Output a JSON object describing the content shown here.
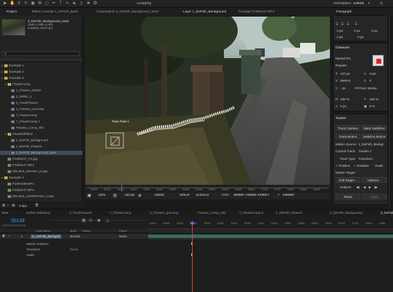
{
  "workspace": {
    "label": "Workspace:",
    "value": "Effects",
    "snapping": "Snapping"
  },
  "panel_tabs": [
    {
      "label": "Project"
    },
    {
      "label": "Effect Controls 1_DeFish_Back"
    },
    {
      "label": "Composition 3_DeFish_Background_track"
    },
    {
      "label": "Layer 1_DeFish_Background"
    },
    {
      "label": "Footage P1050247.MP4"
    },
    {
      "label": "Paragraph"
    }
  ],
  "project": {
    "selected_name": "3_DeFish_Background_track",
    "selected_dims": "1540 x 1080 (1.00)",
    "selected_dur": "Δ 00915, 29.97 fps",
    "items": [
      {
        "label": "Example 1",
        "type": "folder",
        "indent": 0
      },
      {
        "label": "Example 2",
        "type": "folder",
        "indent": 0
      },
      {
        "label": "Example 3",
        "type": "folder",
        "indent": 0
      },
      {
        "label": "FlowerComp",
        "type": "folder",
        "indent": 1
      },
      {
        "label": "1_Flowers_Defish",
        "type": "comp",
        "indent": 2
      },
      {
        "label": "2_Defish_2",
        "type": "comp",
        "indent": 2
      },
      {
        "label": "3_TrackFlowers",
        "type": "comp",
        "indent": 2
      },
      {
        "label": "4_Flowers_precomp",
        "type": "comp",
        "indent": 2
      },
      {
        "label": "7_FlowerComp",
        "type": "comp",
        "indent": 2
      },
      {
        "label": "7_FlowerComp 2",
        "type": "comp",
        "indent": 2
      },
      {
        "label": "Flowers_Comp_Old",
        "type": "comp",
        "indent": 2
      },
      {
        "label": "FlowerDEfish2",
        "type": "folder",
        "indent": 1
      },
      {
        "label": "2_DeFish_Background",
        "type": "comp",
        "indent": 2
      },
      {
        "label": "2_DeFish_Flowers",
        "type": "comp",
        "indent": 2
      },
      {
        "label": "3_DeFish_Background_track",
        "type": "comp",
        "indent": 2
      },
      {
        "label": "P1050247_FS.jpg",
        "type": "foot",
        "indent": 1
      },
      {
        "label": "P1050247.MP4",
        "type": "foot",
        "indent": 1
      },
      {
        "label": "REL8NS_DEFISH_E.aep",
        "type": "foot",
        "indent": 1
      },
      {
        "label": "Example 4",
        "type": "folder",
        "indent": 0
      },
      {
        "label": "P1050189.MP4",
        "type": "foot",
        "indent": 1
      },
      {
        "label": "P1050247.MP4",
        "type": "foot",
        "indent": 1
      },
      {
        "label": "REL8NS_SUPERFISH_4.aep",
        "type": "foot",
        "indent": 1
      }
    ],
    "bpc": "8 bpc"
  },
  "viewer": {
    "track_point": "Track Point 1",
    "ruler": [
      "00050",
      "00100",
      "00150",
      "00200",
      "00250",
      "00300",
      "00350",
      "00400",
      "00450",
      "00500",
      "00550",
      "00600",
      "00650",
      "00700",
      "00750",
      "00800",
      "00850",
      "00900"
    ],
    "zoom": "50%",
    "timecode": "00138",
    "in_point": "00000",
    "out_point": "00914",
    "duration": "Δ 00915",
    "view_label": "View:",
    "view_value": "Motion Tracker Points",
    "render": "Render"
  },
  "paragraph": {
    "title": "Paragraph",
    "rows": [
      [
        "0 px",
        "0 px",
        "0 px"
      ],
      [
        "0 px",
        "0 px"
      ]
    ]
  },
  "character": {
    "title": "Character",
    "font": "Myriad Pro",
    "style": "Regular",
    "size": "137 px",
    "leading": "Auto",
    "kerning": "Metrics",
    "tracking": "0",
    "stroke": "- px",
    "stroke_mode": "Fill Over Stroke",
    "vscale": "100 %",
    "hscale": "100 %",
    "baseline": "0 px",
    "tsume": "0 %"
  },
  "tracker": {
    "title": "Tracker",
    "track_camera": "Track Camera",
    "warp_stabilizer": "Warp Stabilizer",
    "track_motion": "Track Motion",
    "stabilize_motion": "Stabilize Motion",
    "motion_source_label": "Motion Source:",
    "motion_source": "1_DeFish_Backgr",
    "current_track_label": "Current Track:",
    "current_track": "Tracker 1",
    "track_type_label": "Track Type:",
    "track_type": "Transform",
    "position": "Position",
    "rotation": "Rotation",
    "scale": "Scale",
    "motion_target": "Motion Target:",
    "edit_target": "Edit Target...",
    "options": "Options...",
    "analyze": "Analyze:",
    "reset": "Reset",
    "apply": "Apply"
  },
  "timeline_tabs": [
    "1556",
    "Defish Stabilized",
    "3_TrackFlowers",
    "7_FlowerComp",
    "4_Flowers_precomp",
    "Flowers_Comp_Old",
    "7_FlowerComp 2",
    "2_DeFish_Flowers",
    "2_DeFish_Background",
    "3_DeFish"
  ],
  "timeline": {
    "timecode": "00138",
    "timecode_sub": "0:00:04:18 (29.97 fps)",
    "col_layer": "Layer Name",
    "col_mode": "Mode",
    "col_trkmat": "TrkMat",
    "col_parent": "Parent",
    "layer_num": "1",
    "layer_name": "[1_DeFish_Backgrd]",
    "layer_mode": "Normal",
    "layer_parent": "None",
    "sub": [
      "Motion Trackers",
      "Transform",
      "Audio"
    ],
    "reset": "Reset",
    "ruler": [
      "00000",
      "00050",
      "00100",
      "00150",
      "00200",
      "00250",
      "00300",
      "00350",
      "00400",
      "00450",
      "00500",
      "00550",
      "00600",
      "00650",
      "00700",
      "00750",
      "00800",
      "00850"
    ]
  },
  "colors": {
    "accent": "#2d8cff",
    "playhead": "#e0402f",
    "timeline_green": "#3a6b5a",
    "track_path": "#f2efe6"
  }
}
